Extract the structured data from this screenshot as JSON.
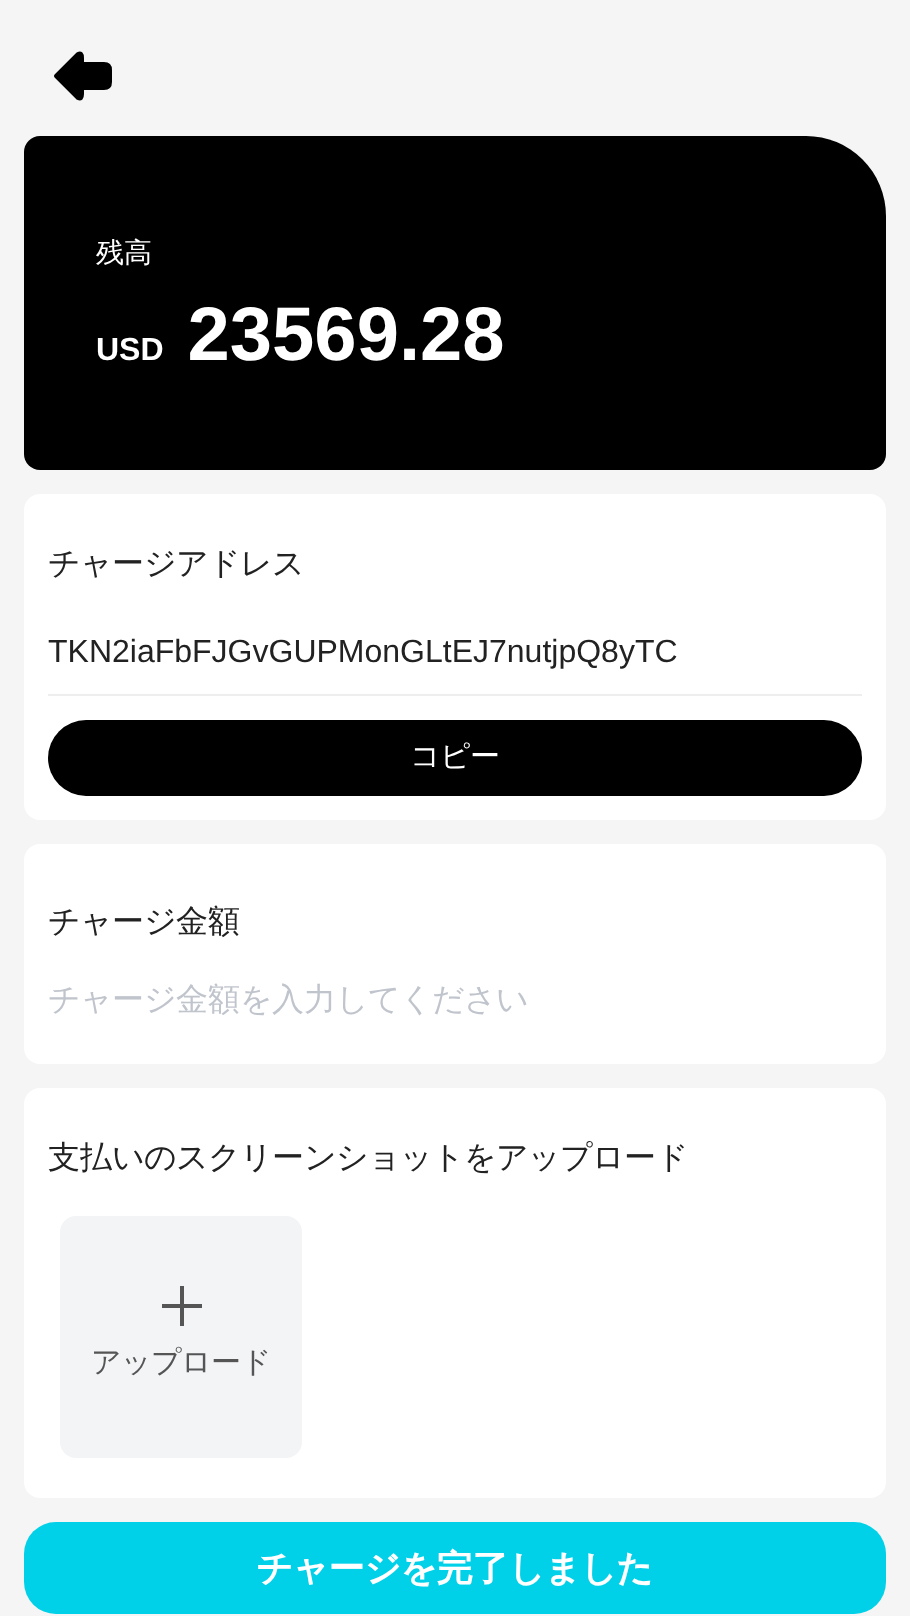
{
  "balance": {
    "label": "残高",
    "currency": "USD",
    "amount": "23569.28"
  },
  "address_card": {
    "title": "チャージアドレス",
    "address": "TKN2iaFbFJGvGUPMonGLtEJ7nutjpQ8yTC",
    "copy_button": "コピー"
  },
  "amount_card": {
    "title": "チャージ金額",
    "placeholder": "チャージ金額を入力してください"
  },
  "upload_card": {
    "title": "支払いのスクリーンショットをアップロード",
    "tile_label": "アップロード"
  },
  "submit_button": "チャージを完了しました"
}
